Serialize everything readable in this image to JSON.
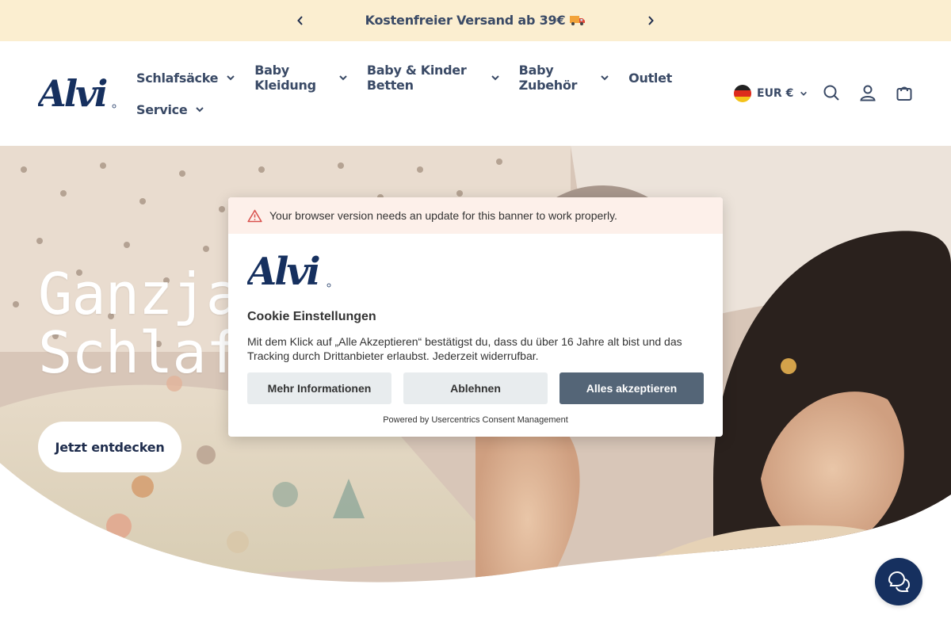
{
  "announcement": {
    "text": "Kostenfreier Versand ab 39€",
    "truck_icon": "truck-emoji"
  },
  "header": {
    "logo_text": "Alvi",
    "nav": [
      {
        "label": "Schlafsäcke",
        "has_dropdown": true
      },
      {
        "label": "Baby Kleidung",
        "has_dropdown": true
      },
      {
        "label": "Baby & Kinder Betten",
        "has_dropdown": true
      },
      {
        "label": "Baby Zubehör",
        "has_dropdown": true
      },
      {
        "label": "Outlet",
        "has_dropdown": false
      },
      {
        "label": "Service",
        "has_dropdown": true
      }
    ],
    "currency": "EUR €",
    "icons": [
      "search-icon",
      "account-icon",
      "cart-icon"
    ]
  },
  "hero": {
    "title_line1": "Ganzja",
    "title_line2": "Schlaf",
    "cta_label": "Jetzt entdecken"
  },
  "cookie": {
    "warning": "Your browser version needs an update for this banner to work properly.",
    "logo_text": "Alvi",
    "title": "Cookie Einstellungen",
    "description": "Mit dem Klick auf „Alle Akzeptieren“ bestätigst du, dass du über 16 Jahre alt bist und das Tracking durch Drittanbieter erlaubst. Jederzeit widerrufbar.",
    "more_label": "Mehr Informationen",
    "deny_label": "Ablehnen",
    "accept_label": "Alles akzeptieren",
    "powered_by": "Powered by Usercentrics Consent Management"
  },
  "colors": {
    "announcement_bg": "#fbeed0",
    "brand_navy": "#16305f",
    "accept_button": "#546577",
    "warning_bg": "#fdf0ea"
  }
}
